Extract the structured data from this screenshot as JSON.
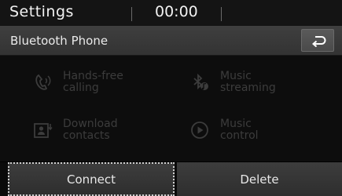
{
  "status_bar": {
    "title": "Settings",
    "clock": "00:00"
  },
  "header": {
    "title": "Bluetooth Phone",
    "back_icon": "back-arrow-icon"
  },
  "features": [
    {
      "label": "Hands-free\ncalling",
      "icon": "handset-icon"
    },
    {
      "label": "Music\nstreaming",
      "icon": "bluetooth-music-icon"
    },
    {
      "label": "Download\ncontacts",
      "icon": "contacts-download-icon"
    },
    {
      "label": "Music\ncontrol",
      "icon": "play-circle-icon"
    }
  ],
  "buttons": {
    "connect": "Connect",
    "delete": "Delete"
  },
  "colors": {
    "disabled_text": "#3c3c3c",
    "focus_outline": "#cfcfcf"
  }
}
